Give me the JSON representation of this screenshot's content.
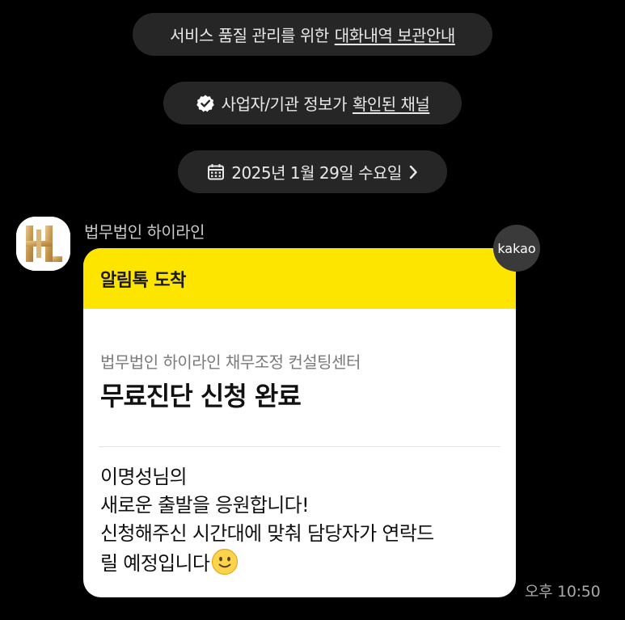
{
  "notices": {
    "storage_text": "서비스 품질 관리를 위한",
    "storage_link": "대화내역 보관안내",
    "verified_text": "사업자/기관 정보가",
    "verified_link": "확인된 채널",
    "date": "2025년 1월 29일 수요일"
  },
  "message": {
    "sender": "법무법인 하이라인",
    "header": "알림톡 도착",
    "subtitle": "법무법인 하이라인 채무조정 컨설팅센터",
    "title": "무료진단 신청 완료",
    "body_lines": [
      "이명성님의",
      "새로운 출발을 응원합니다!",
      "신청해주신 시간대에 맞춰 담당자가 연락드",
      "릴 예정입니다"
    ],
    "badge": "kakao",
    "time": "오후 10:50"
  },
  "icons": {
    "verified": "verified-check-icon",
    "calendar": "calendar-icon",
    "chevron": "chevron-right-icon",
    "emoji": "slightly-smiling-face-icon",
    "avatar_logo": "highline-logo"
  },
  "colors": {
    "background": "#000000",
    "notice_pill": "#262626",
    "header_yellow": "#fee500",
    "bubble": "#ffffff"
  }
}
